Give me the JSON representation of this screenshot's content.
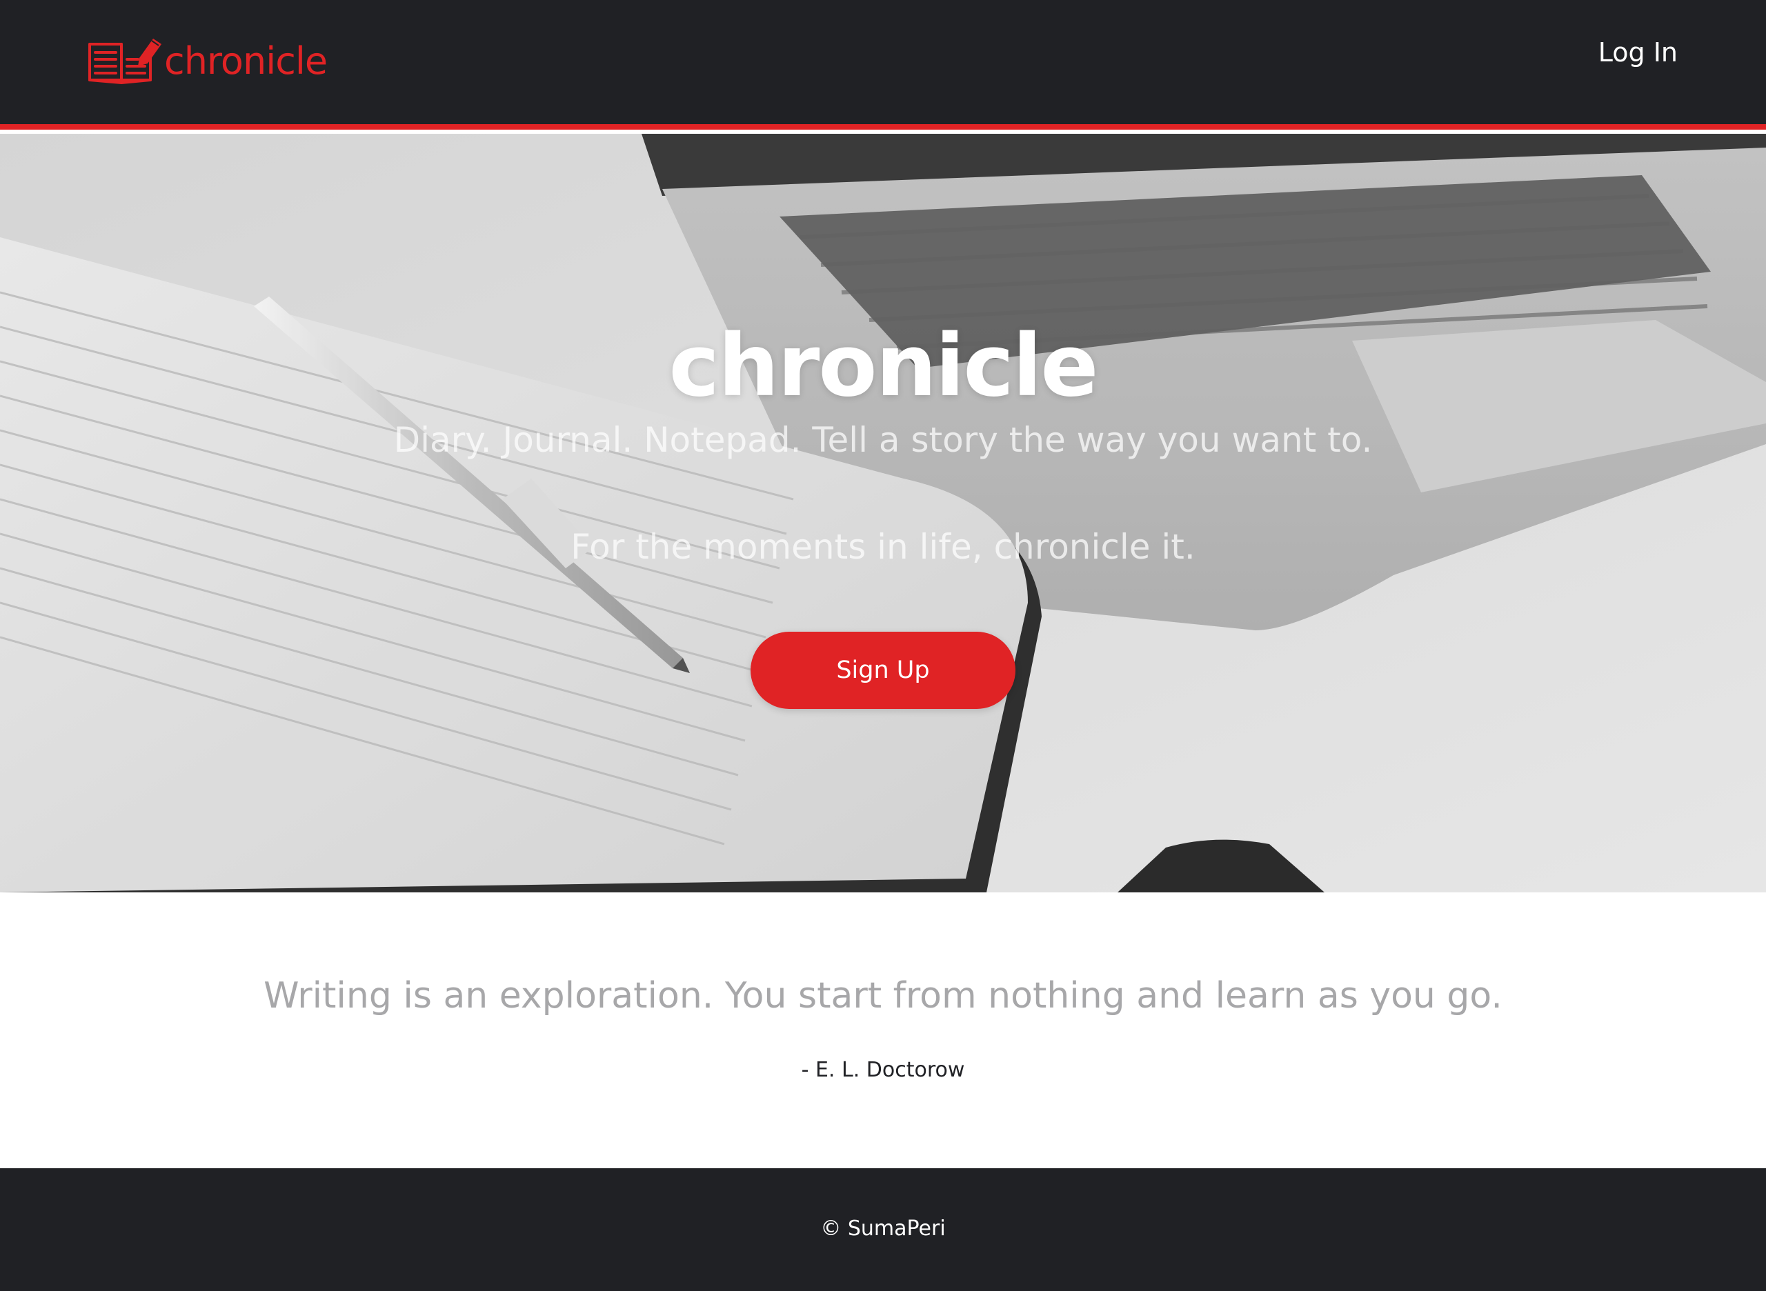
{
  "header": {
    "logo_text": "chronicle",
    "logo_icon": "notebook-pencil-icon",
    "login_label": "Log In"
  },
  "hero": {
    "title": "chronicle",
    "tagline": "Diary. Journal. Notepad. Tell a story the way you want to.",
    "subtagline": "For the moments in life, chronicle it.",
    "signup_label": "Sign Up"
  },
  "quote": {
    "text": "Writing is an exploration. You start from nothing and learn as you go.",
    "author": "- E. L. Doctorow"
  },
  "footer": {
    "copyright": "© SumaPeri"
  },
  "colors": {
    "brand_red": "#e02325",
    "dark_bg": "#202125",
    "quote_gray": "#a7a7a9"
  }
}
